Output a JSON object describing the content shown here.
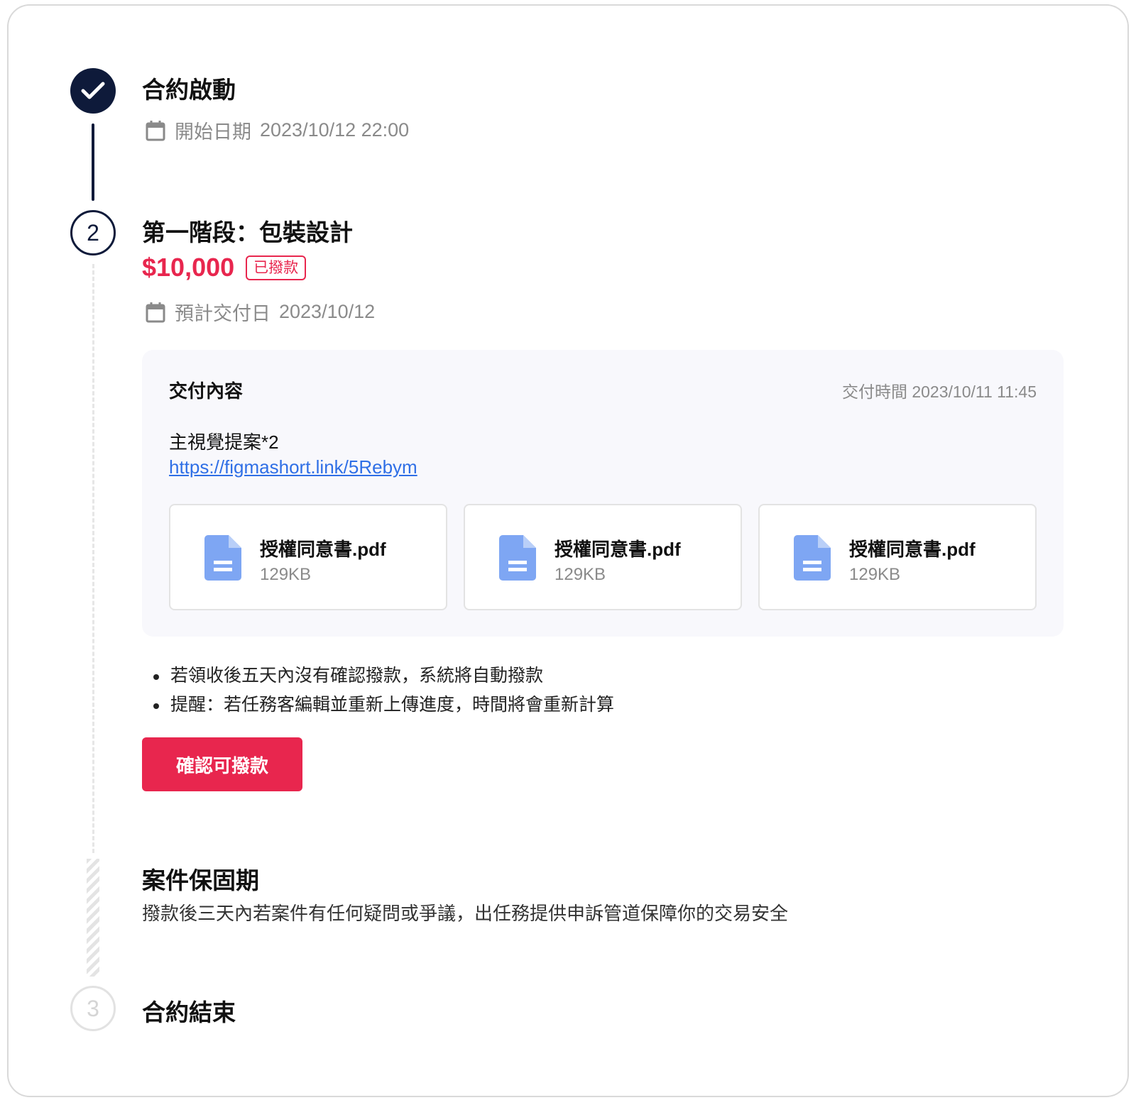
{
  "steps": {
    "start": {
      "title": "合約啟動",
      "date_label": "開始日期",
      "date_value": "2023/10/12 22:00"
    },
    "stage1": {
      "number": "2",
      "title": "第一階段：包裝設計",
      "price": "$10,000",
      "status_badge": "已撥款",
      "due_label": "預計交付日",
      "due_value": "2023/10/12"
    },
    "warranty": {
      "title": "案件保固期",
      "description": "撥款後三天內若案件有任何疑問或爭議，出任務提供申訴管道保障你的交易安全"
    },
    "end": {
      "number": "3",
      "title": "合約結束"
    }
  },
  "delivery": {
    "title": "交付內容",
    "time_label": "交付時間",
    "time_value": "2023/10/11 11:45",
    "description": "主視覺提案*2",
    "link": "https://figmashort.link/5Rebym",
    "files": [
      {
        "name": "授權同意書.pdf",
        "size": "129KB"
      },
      {
        "name": "授權同意書.pdf",
        "size": "129KB"
      },
      {
        "name": "授權同意書.pdf",
        "size": "129KB"
      }
    ]
  },
  "notes": [
    "若領收後五天內沒有確認撥款，系統將自動撥款",
    "提醒：若任務客編輯並重新上傳進度，時間將會重新計算"
  ],
  "actions": {
    "confirm_label": "確認可撥款"
  },
  "icons": {
    "done": "check-icon",
    "calendar": "calendar-icon",
    "file": "document-icon"
  },
  "colors": {
    "navy": "#0e1a3a",
    "accent": "#e8264e",
    "link": "#2f6fe6",
    "file_icon": "#7ea6f3"
  }
}
